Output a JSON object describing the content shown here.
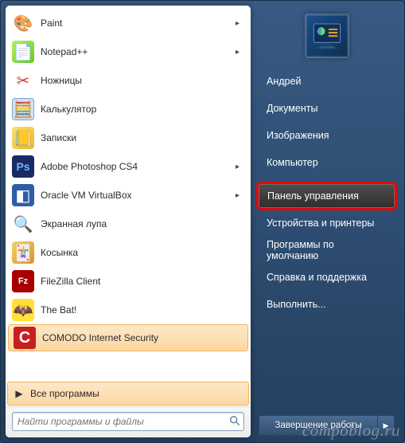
{
  "programs": [
    {
      "label": "Paint",
      "icon": "paint-icon",
      "has_submenu": true
    },
    {
      "label": "Notepad++",
      "icon": "notepad-plus-plus-icon",
      "has_submenu": true
    },
    {
      "label": "Ножницы",
      "icon": "scissors-icon",
      "has_submenu": false
    },
    {
      "label": "Калькулятор",
      "icon": "calculator-icon",
      "has_submenu": false
    },
    {
      "label": "Записки",
      "icon": "sticky-notes-icon",
      "has_submenu": false
    },
    {
      "label": "Adobe Photoshop CS4",
      "icon": "photoshop-icon",
      "has_submenu": true
    },
    {
      "label": "Oracle VM VirtualBox",
      "icon": "virtualbox-icon",
      "has_submenu": true
    },
    {
      "label": "Экранная лупа",
      "icon": "magnifier-icon",
      "has_submenu": false
    },
    {
      "label": "Косынка",
      "icon": "solitaire-icon",
      "has_submenu": false
    },
    {
      "label": "FileZilla Client",
      "icon": "filezilla-icon",
      "has_submenu": false
    },
    {
      "label": "The Bat!",
      "icon": "thebat-icon",
      "has_submenu": false
    },
    {
      "label": "COMODO Internet Security",
      "icon": "comodo-icon",
      "has_submenu": false,
      "recent": true
    }
  ],
  "all_programs_label": "Все программы",
  "search": {
    "placeholder": "Найти программы и файлы"
  },
  "system_items": [
    {
      "label": "Андрей",
      "name": "user-name"
    },
    {
      "label": "Документы",
      "name": "documents"
    },
    {
      "label": "Изображения",
      "name": "pictures"
    },
    {
      "label": "Компьютер",
      "name": "computer",
      "spacer_after": true
    },
    {
      "label": "Панель управления",
      "name": "control-panel",
      "highlighted": true
    },
    {
      "label": "Устройства и принтеры",
      "name": "devices-printers"
    },
    {
      "label": "Программы по умолчанию",
      "name": "default-programs"
    },
    {
      "label": "Справка и поддержка",
      "name": "help-support"
    },
    {
      "label": "Выполнить...",
      "name": "run"
    }
  ],
  "shutdown_label": "Завершение работы",
  "watermark": "compoblog.ru"
}
